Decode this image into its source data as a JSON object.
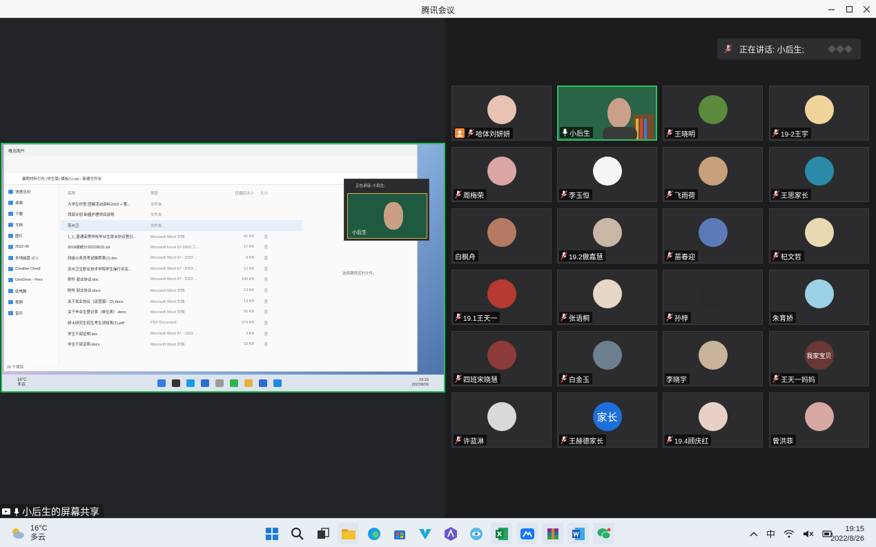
{
  "window": {
    "title": "腾讯会议"
  },
  "speaking": {
    "label": "正在讲话: 小后生;"
  },
  "share": {
    "caption": "小后生的屏幕共享",
    "explorer": {
      "title": "概念图片",
      "address": "暑期材料打包 (学生版) 模板(1).zip  ›  新建文件夹",
      "nav": [
        "快速访问",
        "桌面",
        "下载",
        "文档",
        "图片",
        "2022-06",
        "本地磁盘 (C:)",
        "Creative Cloud",
        "OneDrive - Pers",
        "此电脑",
        "视频",
        "音乐"
      ],
      "headers": [
        "名称",
        "类型",
        "压缩后大小",
        "大小"
      ],
      "files": [
        {
          "name": "大学生村官 团建活动资料2022 + 第...",
          "type": "文件夹",
          "size": "",
          "z": ""
        },
        {
          "name": "西部计划 新疆护理项目说明",
          "type": "文件夹",
          "size": "",
          "z": ""
        },
        {
          "name": "苏州卫",
          "type": "文件夹",
          "size": "",
          "z": ""
        },
        {
          "name": "1_1_普通高等学校毕业生就业协议登记...",
          "type": "Microsoft Word 文档",
          "size": "41 KB",
          "z": "否"
        },
        {
          "name": "2018级统计20220615.xls",
          "type": "Microsoft Excel 97-2003 工...",
          "size": "17 KB",
          "z": "否"
        },
        {
          "name": "四级公务员考试推荐表(1).doc",
          "type": "Microsoft Word 97 - 2003 ...",
          "size": "8 KB",
          "z": "否"
        },
        {
          "name": "苏州卫生职业技术学院学生操行评定...",
          "type": "Microsoft Word 97 - 2003 ...",
          "size": "12 KB",
          "z": "否"
        },
        {
          "name": "附件 就业协议.doc",
          "type": "Microsoft Word 97 - 2003 ...",
          "size": "196 KB",
          "z": "否"
        },
        {
          "name": "附件 就业协议.docx",
          "type": "Microsoft Word 文档",
          "size": "13 KB",
          "z": "否"
        },
        {
          "name": "关于就业协议（运营版）(2).docx",
          "type": "Microsoft Word 文档",
          "size": "13 KB",
          "z": "否"
        },
        {
          "name": "关于毕业生登记表（单位表）.docx",
          "type": "Microsoft Word 文档",
          "size": "56 KB",
          "z": "否"
        },
        {
          "name": "硕士研究生招生考生须知表(1).pdf",
          "type": "PDF Document",
          "size": "374 KB",
          "z": "否"
        },
        {
          "name": "学生干部证明.doc",
          "type": "Microsoft Word 97 - 2003 ...",
          "size": "3 KB",
          "z": "否"
        },
        {
          "name": "学生干部证明.docx",
          "type": "Microsoft Word 文档",
          "size": "10 KB",
          "z": "否"
        }
      ],
      "preview_text": "选择要预览的文件。",
      "status": "20 个项目"
    },
    "mini": {
      "label": "正在讲话: 小后生;",
      "name": "小后生"
    },
    "taskbar": {
      "temp": "16°C",
      "weather": "多云",
      "time": "19:15",
      "date": "2022/8/26"
    }
  },
  "participants": [
    {
      "name": "哈体刘妍妍",
      "avatar_color": "#e8c3b4",
      "host": true
    },
    {
      "name": "小后生",
      "video": true,
      "active": true
    },
    {
      "name": "王晓明",
      "avatar_color": "#5c8a3c"
    },
    {
      "name": "19-2王宇",
      "avatar_color": "#f1d49b"
    },
    {
      "name": "周梅荣",
      "avatar_color": "#d9a6a3"
    },
    {
      "name": "李玉恒",
      "avatar_color": "#f5f5f5"
    },
    {
      "name": "飞雨荷",
      "avatar_color": "#c9a07c"
    },
    {
      "name": "王思家长",
      "avatar_color": "#2a8aa8"
    },
    {
      "name": "白枫舟",
      "avatar_color": "#b57a64",
      "no_mic": true
    },
    {
      "name": "19.2傲嘉慧",
      "avatar_color": "#c9b6a5"
    },
    {
      "name": "苗春迎",
      "avatar_color": "#5a7bb8"
    },
    {
      "name": "杞文哲",
      "avatar_color": "#e9d9b2"
    },
    {
      "name": "19.1王天一",
      "avatar_color": "#b63a32"
    },
    {
      "name": "张语桐",
      "avatar_color": "#e8d7c6"
    },
    {
      "name": "孙梓",
      "avatar_color": "#2b2b2b"
    },
    {
      "name": "朱育娇",
      "avatar_color": "#9ad1e6",
      "no_mic": true
    },
    {
      "name": "四班宋晓慧",
      "avatar_color": "#8c3a3a"
    },
    {
      "name": "白金玉",
      "avatar_color": "#6e7f8f"
    },
    {
      "name": "李晓宇",
      "avatar_color": "#c7b49a",
      "no_mic": true
    },
    {
      "name": "王天一妈妈",
      "avatar_color": "#6b3737",
      "avatar_text": "我家宝贝"
    },
    {
      "name": "许蓝淋",
      "avatar_color": "#d9d9d9"
    },
    {
      "name": "王赫德家长",
      "avatar_color": "#1e6fdc",
      "avatar_text": "家长"
    },
    {
      "name": "19.4顾庆红",
      "avatar_color": "#e8d0c4"
    },
    {
      "name": "曾洪菲",
      "avatar_color": "#d8a8a4",
      "no_mic": true
    }
  ],
  "taskbar": {
    "temp": "16°C",
    "weather": "多云",
    "ime": "中",
    "time": "19:15",
    "date": "2022/8/26",
    "apps": [
      "start-icon",
      "search-icon",
      "task-view-icon",
      "file-explorer-icon",
      "edge-icon",
      "store-icon",
      "vector-app-icon",
      "arc-app-icon",
      "browser-app-icon",
      "excel-icon",
      "tencent-meeting-icon",
      "winrar-icon",
      "word-icon",
      "wechat-icon"
    ]
  }
}
